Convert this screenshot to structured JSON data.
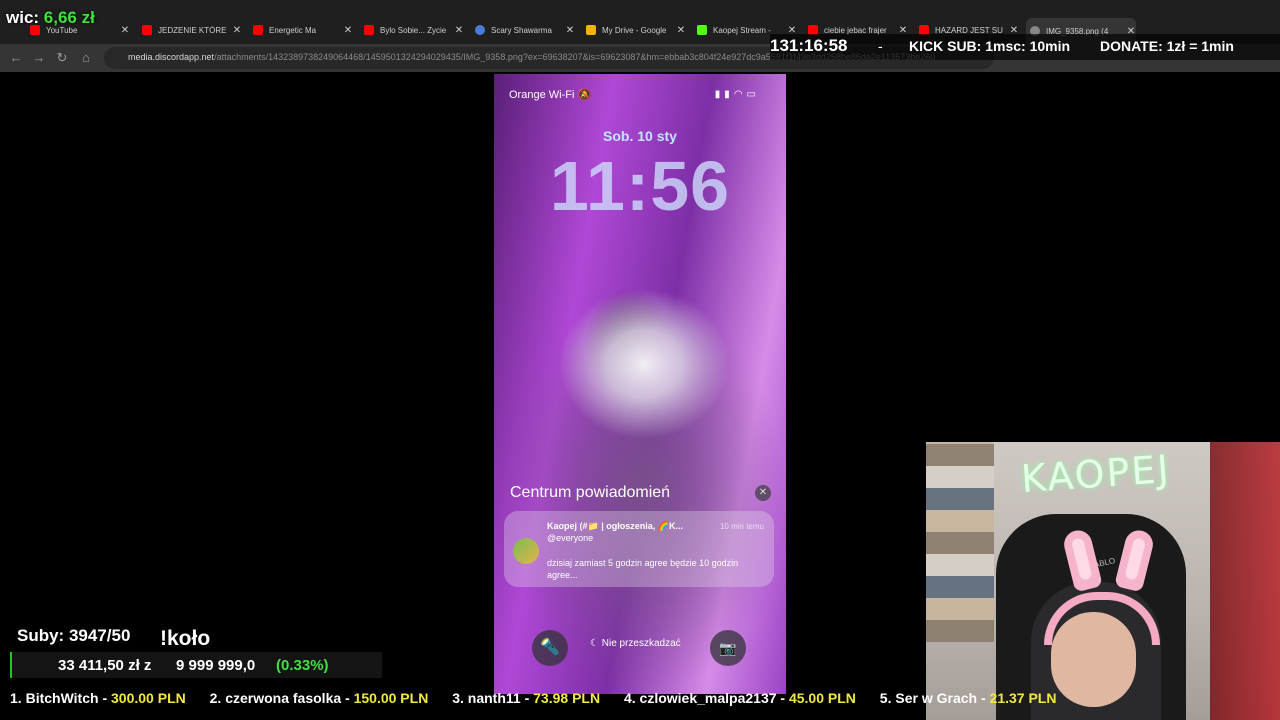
{
  "overlay": {
    "wic_label": "wic:",
    "wic_value": "6,66 zł",
    "timer": "131:16:58",
    "dash": "-",
    "kick_sub": "KICK SUB: 1msc: 10min",
    "donate": "DONATE: 1zł = 1min",
    "subs": "Suby: 3947/50",
    "kolo": "!koło",
    "goal_current": "33 411,50 zł z",
    "goal_max": "9 999 999,0",
    "goal_percent_text": "(0.33%)",
    "goal_fraction": 0.0033,
    "ticker": [
      {
        "rank": "1.",
        "name": "BitchWitch -",
        "amount": "300.00 PLN"
      },
      {
        "rank": "2.",
        "name": "czerwona fasolka -",
        "amount": "150.00 PLN"
      },
      {
        "rank": "3.",
        "name": "nanth11 -",
        "amount": "73.98 PLN"
      },
      {
        "rank": "4.",
        "name": "czlowiek_malpa2137 -",
        "amount": "45.00 PLN"
      },
      {
        "rank": "5.",
        "name": "Ser w Grach -",
        "amount": "21.37 PLN"
      }
    ]
  },
  "browser": {
    "tabs": [
      {
        "title": "YouTube",
        "favicon_color": "#ff0000",
        "icon": "youtube-icon"
      },
      {
        "title": "JEDZENIE KTÓRE",
        "favicon_color": "#ff0000",
        "icon": "youtube-icon"
      },
      {
        "title": "Energetic Ma",
        "favicon_color": "#ff0000",
        "icon": "youtube-icon"
      },
      {
        "title": "Bylo Sobie... Zycie",
        "favicon_color": "#ff0000",
        "icon": "youtube-icon"
      },
      {
        "title": "Scary Shawarma",
        "favicon_color": "#4a7bd8",
        "icon": "globe-icon"
      },
      {
        "title": "My Drive - Google",
        "favicon_color": "#f4b400",
        "icon": "drive-icon"
      },
      {
        "title": "Kaopej Stream -",
        "favicon_color": "#53fc18",
        "icon": "kick-icon"
      },
      {
        "title": "ciebie jebac frajer",
        "favicon_color": "#ff0000",
        "icon": "youtube-icon"
      },
      {
        "title": "HAZARD JEST SU",
        "favicon_color": "#ff0000",
        "icon": "youtube-icon"
      },
      {
        "title": "IMG_9358.png (4",
        "favicon_color": "#888888",
        "icon": "globe-icon"
      }
    ],
    "url_host": "media.discordapp.net",
    "url_path": "/attachments/1432389738249064468/1459501324294029435/IMG_9358.png?ex=69638207&is=69623087&hm=ebbab3c804f24e927dc9a5581f1f49e3dd258be86da2e113573be260"
  },
  "phone": {
    "carrier": "Orange Wi-Fi",
    "date": "Sob. 10 sty",
    "time": "11:56",
    "notification_center": "Centrum powiadomień",
    "notification": {
      "title": "Kaopej (#📁 | ogłoszenia, 🌈K...",
      "time": "10 min temu",
      "mention": "@everyone",
      "body": "dzisiaj zamiast 5 godzin agree będzie 10 godzin agree..."
    },
    "focus_label": "Nie przeszkadzać"
  },
  "webcam": {
    "neon_sign": "KAOPEJ",
    "chair_logo": "DIABLO"
  }
}
